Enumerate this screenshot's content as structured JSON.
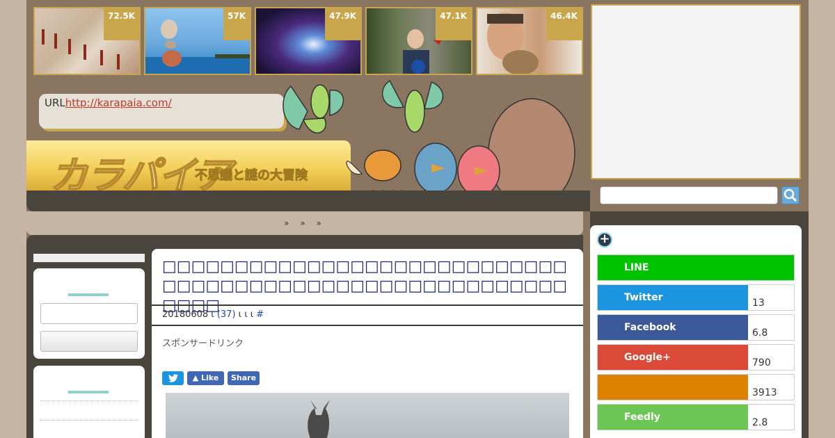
{
  "thumbnails": [
    {
      "count": "72.5K",
      "icon": "cave-art-image"
    },
    {
      "count": "57K",
      "icon": "balanced-stones-image"
    },
    {
      "count": "47.9K",
      "icon": "galaxy-image"
    },
    {
      "count": "47.1K",
      "icon": "boy-in-forest-image"
    },
    {
      "count": "46.4K",
      "icon": "man-with-cat-image"
    }
  ],
  "header": {
    "url_label": "URL",
    "url_link": "http://karapaia.com/",
    "logo": "カラパイア",
    "tagline": "不思議と謎の大冒険",
    "nav": "» » »"
  },
  "article": {
    "title": "□□□□□□□□□□□□□□□□□□□□□□□□□□□□□□□□□□□□□□□□□□□□□□□□□□□□□□□□□□□□",
    "meta_date": "20180608 ι",
    "meta_comments": "(37)",
    "meta_mid": " ι ι ι",
    "meta_hash": "#",
    "sponsor": "スポンサードリンク",
    "twitter_icon": "twitter-bird-icon",
    "like_label": "Like",
    "share_label": "Share"
  },
  "share": [
    {
      "name": "LINE",
      "count": "",
      "color": "#00c300"
    },
    {
      "name": "Twitter",
      "count": "13",
      "color": "#1b95e0"
    },
    {
      "name": "Facebook",
      "count": "6.8",
      "color": "#3b5998"
    },
    {
      "name": "Google+",
      "count": "790",
      "color": "#db4a39"
    },
    {
      "name": "",
      "count": "3913",
      "color": "#dd8200"
    },
    {
      "name": "Feedly",
      "count": "2.8",
      "color": "#6cc655"
    }
  ],
  "colors": {
    "accent_gold": "#c9a64b",
    "dark_band": "#4a463e",
    "title_blue": "#1a237e"
  }
}
